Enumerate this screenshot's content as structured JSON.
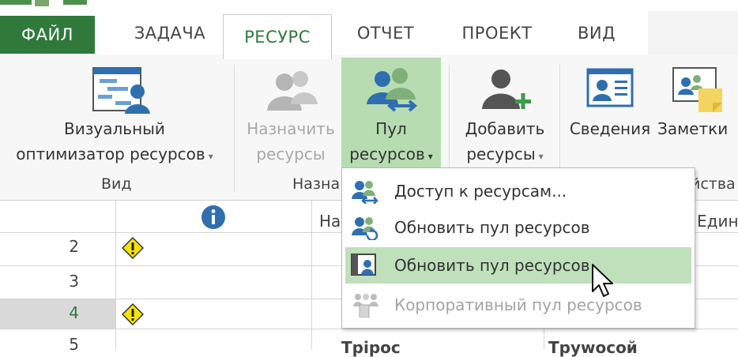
{
  "tabs": [
    {
      "label": "ФАЙЛ"
    },
    {
      "label": "ЗАДАЧА"
    },
    {
      "label": "РЕСУРС"
    },
    {
      "label": "ОТЧЕТ"
    },
    {
      "label": "ПРОЕКТ"
    },
    {
      "label": "ВИД"
    }
  ],
  "ribbon": {
    "visual_optimizer": {
      "line1": "Визуальный",
      "line2": "оптимизатор ресурсов"
    },
    "assign": {
      "line1": "Назначить",
      "line2": "ресурсы"
    },
    "pool": {
      "line1": "Пул",
      "line2": "ресурсов"
    },
    "add": {
      "line1": "Добавить",
      "line2": "ресурсы"
    },
    "info": {
      "label": "Сведения"
    },
    "notes": {
      "label": "Заметки"
    },
    "groups": {
      "view": "Вид",
      "assign": "Назна",
      "props": "йства"
    }
  },
  "menu": {
    "items": [
      {
        "label": "Доступ к ресурсам...",
        "icon": "share-resources-icon"
      },
      {
        "label": "Обновить пул ресурсов",
        "icon": "refresh-pool-icon"
      },
      {
        "label": "Обновить пул ресурсов",
        "icon": "update-pool-icon"
      },
      {
        "label": "Корпоративный пул ресурсов",
        "icon": "enterprise-pool-icon"
      }
    ]
  },
  "grid": {
    "header_name_partial": "На",
    "header_units_partial": "Едини",
    "rows": [
      "2",
      "3",
      "4",
      "5"
    ],
    "row5_partial_a": "Tpipoc",
    "row5_partial_b": "Tpywocoй"
  },
  "colors": {
    "accent": "#2f7a3b",
    "highlight": "#b7dcb1",
    "info_blue": "#2f6fb0",
    "warning_yellow": "#f5e400"
  }
}
